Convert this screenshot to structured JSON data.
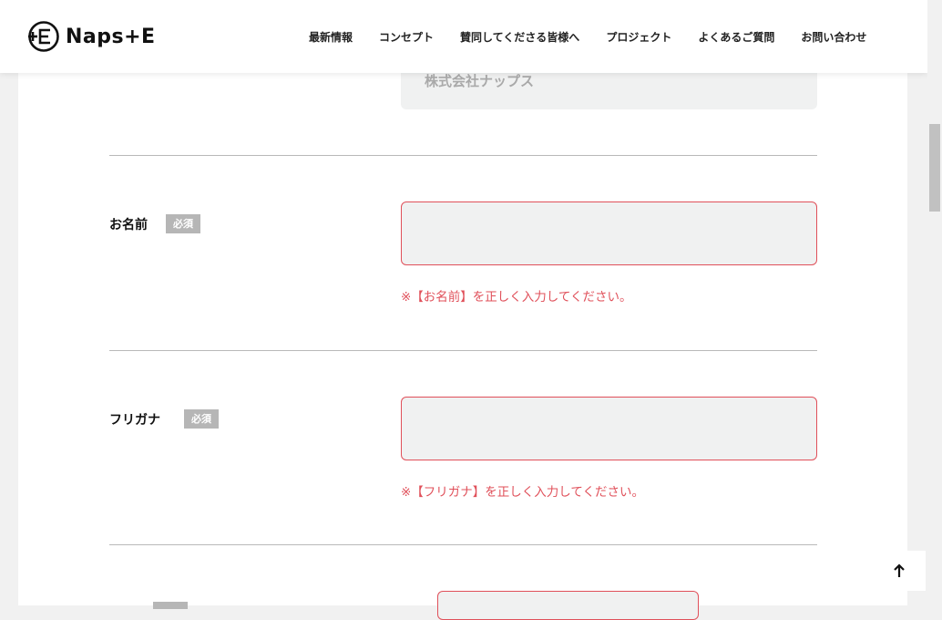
{
  "header": {
    "logo_text": "Naps+E",
    "nav": [
      "最新情報",
      "コンセプト",
      "賛同してくださる皆様へ",
      "プロジェクト",
      "よくあるご質問",
      "お問い合わせ"
    ]
  },
  "company": {
    "value": "株式会社ナップス"
  },
  "fields": [
    {
      "label": "お名前",
      "badge": "必須",
      "error": "※【お名前】を正しく入力してください。"
    },
    {
      "label": "フリガナ",
      "badge": "必須",
      "error": "※【フリガナ】を正しく入力してください。"
    }
  ],
  "icons": {
    "back_to_top": "arrow-up-icon",
    "logo": "plus-e-logo-icon"
  },
  "colors": {
    "error": "#e0505a",
    "badge": "#b6b6b6",
    "input_bg": "#f0f1f1"
  }
}
